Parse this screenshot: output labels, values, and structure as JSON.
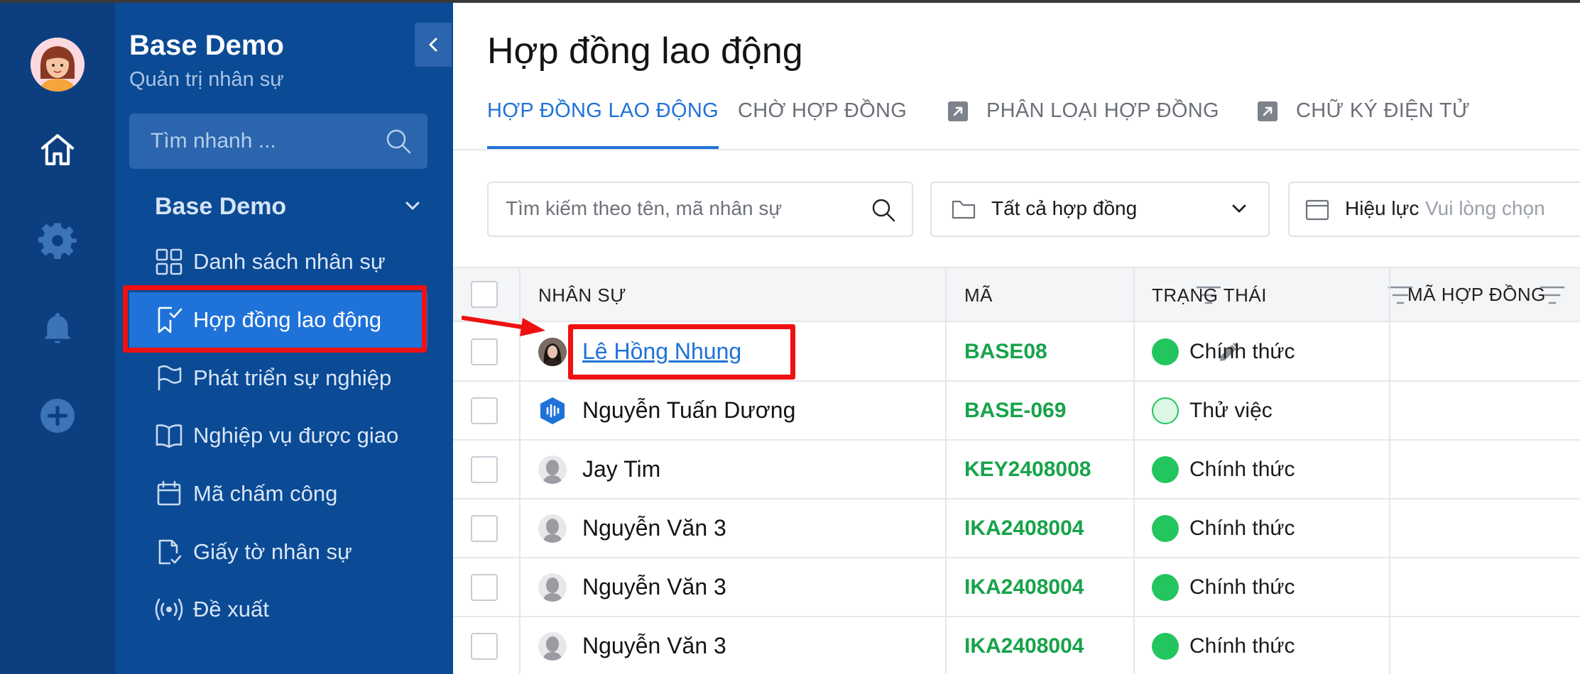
{
  "colors": {
    "sidebar": "#0b4a94",
    "rail": "#0d3f80",
    "accent": "#1f72d8",
    "green": "#17a34a",
    "highlight": "#ef1111"
  },
  "rail": {
    "icons": [
      "home-icon",
      "gear-icon",
      "bell-icon",
      "plus-circle-icon"
    ]
  },
  "sidebar": {
    "brand_title": "Base Demo",
    "brand_subtitle": "Quản trị nhân sự",
    "search_placeholder": "Tìm nhanh ...",
    "group_title": "Base Demo",
    "items": [
      {
        "label": "Danh sách nhân sự",
        "icon": "grid-icon"
      },
      {
        "label": "Hợp đồng lao động",
        "icon": "document-check-icon",
        "active": true
      },
      {
        "label": "Phát triển sự nghiệp",
        "icon": "flag-icon"
      },
      {
        "label": "Nghiệp vụ được giao",
        "icon": "book-icon"
      },
      {
        "label": "Mã chấm công",
        "icon": "calendar-icon"
      },
      {
        "label": "Giấy tờ nhân sự",
        "icon": "file-check-icon"
      },
      {
        "label": "Đề xuất",
        "icon": "broadcast-icon"
      }
    ]
  },
  "main": {
    "title": "Hợp đồng lao động",
    "tabs": [
      {
        "label": "HỢP ĐỒNG LAO ĐỘNG",
        "active": true
      },
      {
        "label": "CHỜ HỢP ĐỒNG"
      },
      {
        "label": "PHÂN LOẠI HỢP ĐỒNG",
        "external": true
      },
      {
        "label": "CHỮ KÝ ĐIỆN TỬ",
        "external": true
      }
    ],
    "filters": {
      "search_placeholder": "Tìm kiếm theo tên, mã nhân sự",
      "contract_select": "Tất cả hợp đồng",
      "validity_label": "Hiệu lực",
      "validity_placeholder": "Vui lòng chọn"
    },
    "table": {
      "columns": [
        "NHÂN SỰ",
        "MÃ",
        "TRẠNG THÁI",
        "MÃ HỢP ĐỒNG"
      ],
      "rows": [
        {
          "name": "Lê Hồng Nhung",
          "code": "BASE08",
          "status": "Chính thức",
          "avatar": "photo"
        },
        {
          "name": "Nguyễn Tuấn Dương",
          "code": "BASE-069",
          "status": "Thử việc",
          "avatar": "brand"
        },
        {
          "name": "Jay Tim",
          "code": "KEY2408008",
          "status": "Chính thức",
          "avatar": "default"
        },
        {
          "name": "Nguyễn Văn 3",
          "code": "IKA2408004",
          "status": "Chính thức",
          "avatar": "default"
        },
        {
          "name": "Nguyễn Văn 3",
          "code": "IKA2408004",
          "status": "Chính thức",
          "avatar": "default"
        },
        {
          "name": "Nguyễn Văn 3",
          "code": "IKA2408004",
          "status": "Chính thức",
          "avatar": "default"
        }
      ]
    }
  }
}
